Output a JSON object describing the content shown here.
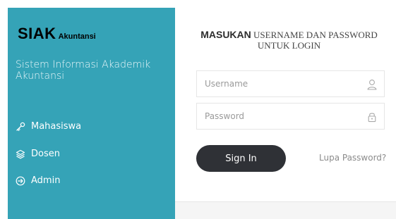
{
  "sidebar": {
    "brand": "SIAK",
    "brand_sub": "Akuntansi",
    "description": "Sistem Informasi Akademik Akuntansi",
    "items": [
      {
        "label": "Mahasiswa",
        "icon": "key-icon"
      },
      {
        "label": "Dosen",
        "icon": "layers-icon"
      },
      {
        "label": "Admin",
        "icon": "arrow-circle-right-icon"
      }
    ]
  },
  "form": {
    "heading_bold": "MASUKAN",
    "heading_rest": "USERNAME DAN PASSWORD UNTUK LOGIN",
    "username_placeholder": "Username",
    "password_placeholder": "Password",
    "username_value": "",
    "password_value": "",
    "username_icon": "user-icon",
    "password_icon": "lock-icon",
    "signin_label": "Sign In",
    "forgot_label": "Lupa Password?"
  },
  "colors": {
    "sidebar_bg": "#35a3b7",
    "button_bg": "#2f3136",
    "muted_text": "#8b8b8b"
  }
}
